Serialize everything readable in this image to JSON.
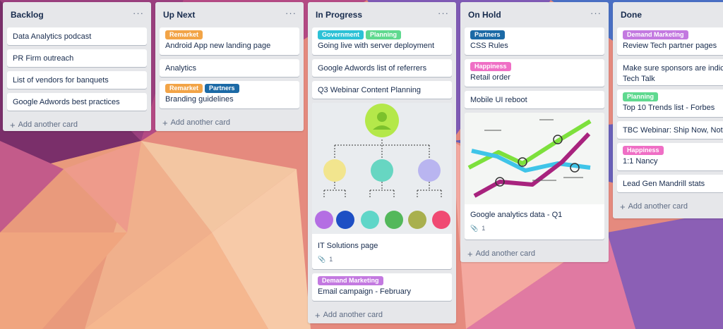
{
  "colors": {
    "remarket": "#f2a447",
    "partners": "#1c6aa6",
    "government": "#2cc1d6",
    "planning": "#5fd98f",
    "happiness": "#ef6fc5",
    "demand_marketing": "#c379e0",
    "list_bg": "#e6e7ea"
  },
  "lists": [
    {
      "title": "Backlog",
      "menu": "···",
      "cards": [
        {
          "text": "Data Analytics podcast"
        },
        {
          "text": "PR Firm outreach"
        },
        {
          "text": "List of vendors for banquets"
        },
        {
          "text": "Google Adwords best practices"
        }
      ],
      "add": "Add another card"
    },
    {
      "title": "Up Next",
      "menu": "···",
      "cards": [
        {
          "text": "Android App new landing page",
          "labels": [
            "Remarket"
          ]
        },
        {
          "text": "Analytics"
        },
        {
          "text": "Branding guidelines",
          "labels": [
            "Remarket",
            "Partners"
          ]
        }
      ],
      "add": "Add another card"
    },
    {
      "title": "In Progress",
      "menu": "···",
      "cards": [
        {
          "text": "Going live with server deployment",
          "labels": [
            "Government",
            "Planning"
          ]
        },
        {
          "text": "Google Adwords list of referrers"
        },
        {
          "text": "Q3 Webinar Content Planning"
        },
        {
          "text": "IT Solutions page",
          "attachments": "1",
          "cover": "org-chart"
        },
        {
          "text": "Email campaign - February",
          "labels": [
            "Demand Marketing"
          ]
        }
      ],
      "add": "Add another card"
    },
    {
      "title": "On Hold",
      "menu": "···",
      "cards": [
        {
          "text": "CSS Rules",
          "labels": [
            "Partners"
          ]
        },
        {
          "text": "Retail order",
          "labels": [
            "Happiness"
          ]
        },
        {
          "text": "Mobile UI reboot"
        },
        {
          "text": "Google analytics data - Q1",
          "attachments": "1",
          "cover": "line-chart"
        }
      ],
      "add": "Add another card"
    },
    {
      "title": "Done",
      "menu": "···",
      "cards": [
        {
          "text": "Review Tech partner pages",
          "labels": [
            "Demand Marketing"
          ]
        },
        {
          "text": "Make sure sponsors are indica",
          "text2": "Tech Talk"
        },
        {
          "text": "Top 10 Trends list - Forbes",
          "labels": [
            "Planning"
          ]
        },
        {
          "text": "TBC Webinar: Ship Now, Not l"
        },
        {
          "text": "1:1 Nancy",
          "labels": [
            "Happiness"
          ]
        },
        {
          "text": "Lead Gen Mandrill stats"
        }
      ],
      "add": "Add another card"
    }
  ],
  "icons": {
    "attachment": "paperclip-icon",
    "add": "plus-icon",
    "menu": "ellipsis-icon"
  }
}
